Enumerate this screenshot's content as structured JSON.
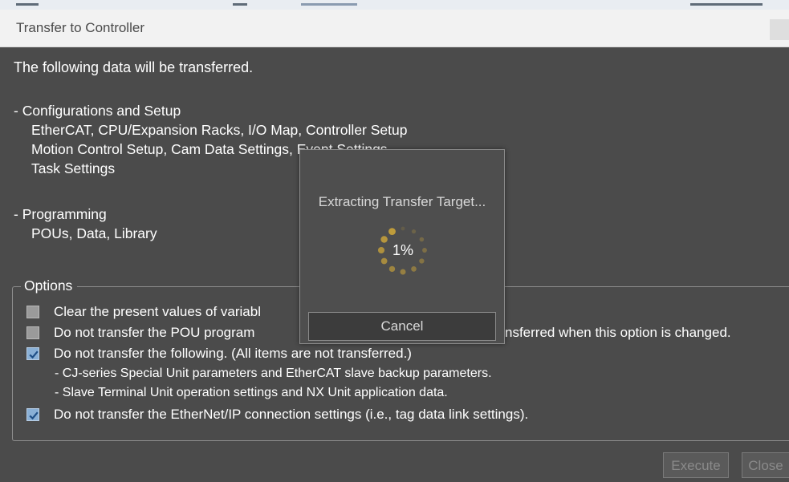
{
  "window": {
    "title": "Transfer to Controller"
  },
  "content": {
    "lead": "The following data will be transferred.",
    "sections": [
      {
        "header": "- Configurations and Setup",
        "lines": [
          "EtherCAT, CPU/Expansion Racks, I/O Map, Controller Setup",
          "Motion Control Setup, Cam Data Settings, Event Settings",
          "Task Settings"
        ]
      },
      {
        "header": "- Programming",
        "lines": [
          "POUs, Data, Library"
        ]
      }
    ]
  },
  "options": {
    "legend": "Options",
    "items": [
      {
        "label": "Clear the present values of variabl",
        "checked": false
      },
      {
        "label": "Do not transfer the POU program",
        "label_tail": "nsferred when this option is changed.",
        "checked": false
      },
      {
        "label": "Do not transfer the following. (All items are not transferred.)",
        "checked": true,
        "sublines": [
          "- CJ-series Special Unit parameters and EtherCAT slave backup parameters.",
          "- Slave Terminal Unit operation settings and NX Unit application data."
        ]
      },
      {
        "label": "Do not transfer the EtherNet/IP connection settings (i.e., tag data link settings).",
        "checked": true
      }
    ]
  },
  "buttons": {
    "execute": "Execute",
    "close": "Close"
  },
  "progress_dialog": {
    "message": "Extracting Transfer Target...",
    "percent_text": "1%",
    "progress_fraction": 0.01,
    "cancel": "Cancel"
  },
  "colors": {
    "spinner": "#c8a23a",
    "content_bg": "#4b4b4b",
    "checkbox_checked": "#8ab0d6"
  }
}
